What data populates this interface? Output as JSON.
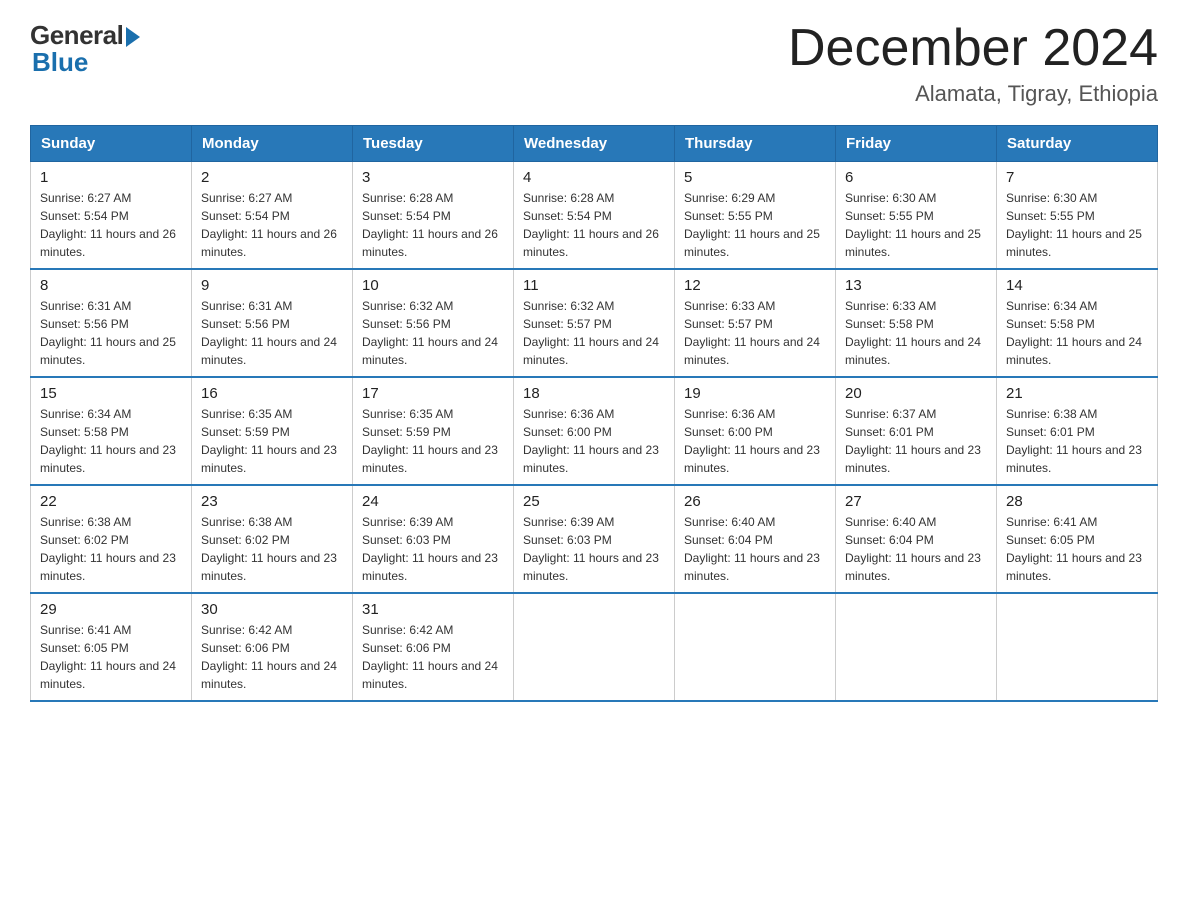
{
  "logo": {
    "general": "General",
    "blue": "Blue"
  },
  "header": {
    "month_year": "December 2024",
    "location": "Alamata, Tigray, Ethiopia"
  },
  "weekdays": [
    "Sunday",
    "Monday",
    "Tuesday",
    "Wednesday",
    "Thursday",
    "Friday",
    "Saturday"
  ],
  "weeks": [
    [
      {
        "day": "1",
        "sunrise": "6:27 AM",
        "sunset": "5:54 PM",
        "daylight": "11 hours and 26 minutes."
      },
      {
        "day": "2",
        "sunrise": "6:27 AM",
        "sunset": "5:54 PM",
        "daylight": "11 hours and 26 minutes."
      },
      {
        "day": "3",
        "sunrise": "6:28 AM",
        "sunset": "5:54 PM",
        "daylight": "11 hours and 26 minutes."
      },
      {
        "day": "4",
        "sunrise": "6:28 AM",
        "sunset": "5:54 PM",
        "daylight": "11 hours and 26 minutes."
      },
      {
        "day": "5",
        "sunrise": "6:29 AM",
        "sunset": "5:55 PM",
        "daylight": "11 hours and 25 minutes."
      },
      {
        "day": "6",
        "sunrise": "6:30 AM",
        "sunset": "5:55 PM",
        "daylight": "11 hours and 25 minutes."
      },
      {
        "day": "7",
        "sunrise": "6:30 AM",
        "sunset": "5:55 PM",
        "daylight": "11 hours and 25 minutes."
      }
    ],
    [
      {
        "day": "8",
        "sunrise": "6:31 AM",
        "sunset": "5:56 PM",
        "daylight": "11 hours and 25 minutes."
      },
      {
        "day": "9",
        "sunrise": "6:31 AM",
        "sunset": "5:56 PM",
        "daylight": "11 hours and 24 minutes."
      },
      {
        "day": "10",
        "sunrise": "6:32 AM",
        "sunset": "5:56 PM",
        "daylight": "11 hours and 24 minutes."
      },
      {
        "day": "11",
        "sunrise": "6:32 AM",
        "sunset": "5:57 PM",
        "daylight": "11 hours and 24 minutes."
      },
      {
        "day": "12",
        "sunrise": "6:33 AM",
        "sunset": "5:57 PM",
        "daylight": "11 hours and 24 minutes."
      },
      {
        "day": "13",
        "sunrise": "6:33 AM",
        "sunset": "5:58 PM",
        "daylight": "11 hours and 24 minutes."
      },
      {
        "day": "14",
        "sunrise": "6:34 AM",
        "sunset": "5:58 PM",
        "daylight": "11 hours and 24 minutes."
      }
    ],
    [
      {
        "day": "15",
        "sunrise": "6:34 AM",
        "sunset": "5:58 PM",
        "daylight": "11 hours and 23 minutes."
      },
      {
        "day": "16",
        "sunrise": "6:35 AM",
        "sunset": "5:59 PM",
        "daylight": "11 hours and 23 minutes."
      },
      {
        "day": "17",
        "sunrise": "6:35 AM",
        "sunset": "5:59 PM",
        "daylight": "11 hours and 23 minutes."
      },
      {
        "day": "18",
        "sunrise": "6:36 AM",
        "sunset": "6:00 PM",
        "daylight": "11 hours and 23 minutes."
      },
      {
        "day": "19",
        "sunrise": "6:36 AM",
        "sunset": "6:00 PM",
        "daylight": "11 hours and 23 minutes."
      },
      {
        "day": "20",
        "sunrise": "6:37 AM",
        "sunset": "6:01 PM",
        "daylight": "11 hours and 23 minutes."
      },
      {
        "day": "21",
        "sunrise": "6:38 AM",
        "sunset": "6:01 PM",
        "daylight": "11 hours and 23 minutes."
      }
    ],
    [
      {
        "day": "22",
        "sunrise": "6:38 AM",
        "sunset": "6:02 PM",
        "daylight": "11 hours and 23 minutes."
      },
      {
        "day": "23",
        "sunrise": "6:38 AM",
        "sunset": "6:02 PM",
        "daylight": "11 hours and 23 minutes."
      },
      {
        "day": "24",
        "sunrise": "6:39 AM",
        "sunset": "6:03 PM",
        "daylight": "11 hours and 23 minutes."
      },
      {
        "day": "25",
        "sunrise": "6:39 AM",
        "sunset": "6:03 PM",
        "daylight": "11 hours and 23 minutes."
      },
      {
        "day": "26",
        "sunrise": "6:40 AM",
        "sunset": "6:04 PM",
        "daylight": "11 hours and 23 minutes."
      },
      {
        "day": "27",
        "sunrise": "6:40 AM",
        "sunset": "6:04 PM",
        "daylight": "11 hours and 23 minutes."
      },
      {
        "day": "28",
        "sunrise": "6:41 AM",
        "sunset": "6:05 PM",
        "daylight": "11 hours and 23 minutes."
      }
    ],
    [
      {
        "day": "29",
        "sunrise": "6:41 AM",
        "sunset": "6:05 PM",
        "daylight": "11 hours and 24 minutes."
      },
      {
        "day": "30",
        "sunrise": "6:42 AM",
        "sunset": "6:06 PM",
        "daylight": "11 hours and 24 minutes."
      },
      {
        "day": "31",
        "sunrise": "6:42 AM",
        "sunset": "6:06 PM",
        "daylight": "11 hours and 24 minutes."
      },
      null,
      null,
      null,
      null
    ]
  ]
}
